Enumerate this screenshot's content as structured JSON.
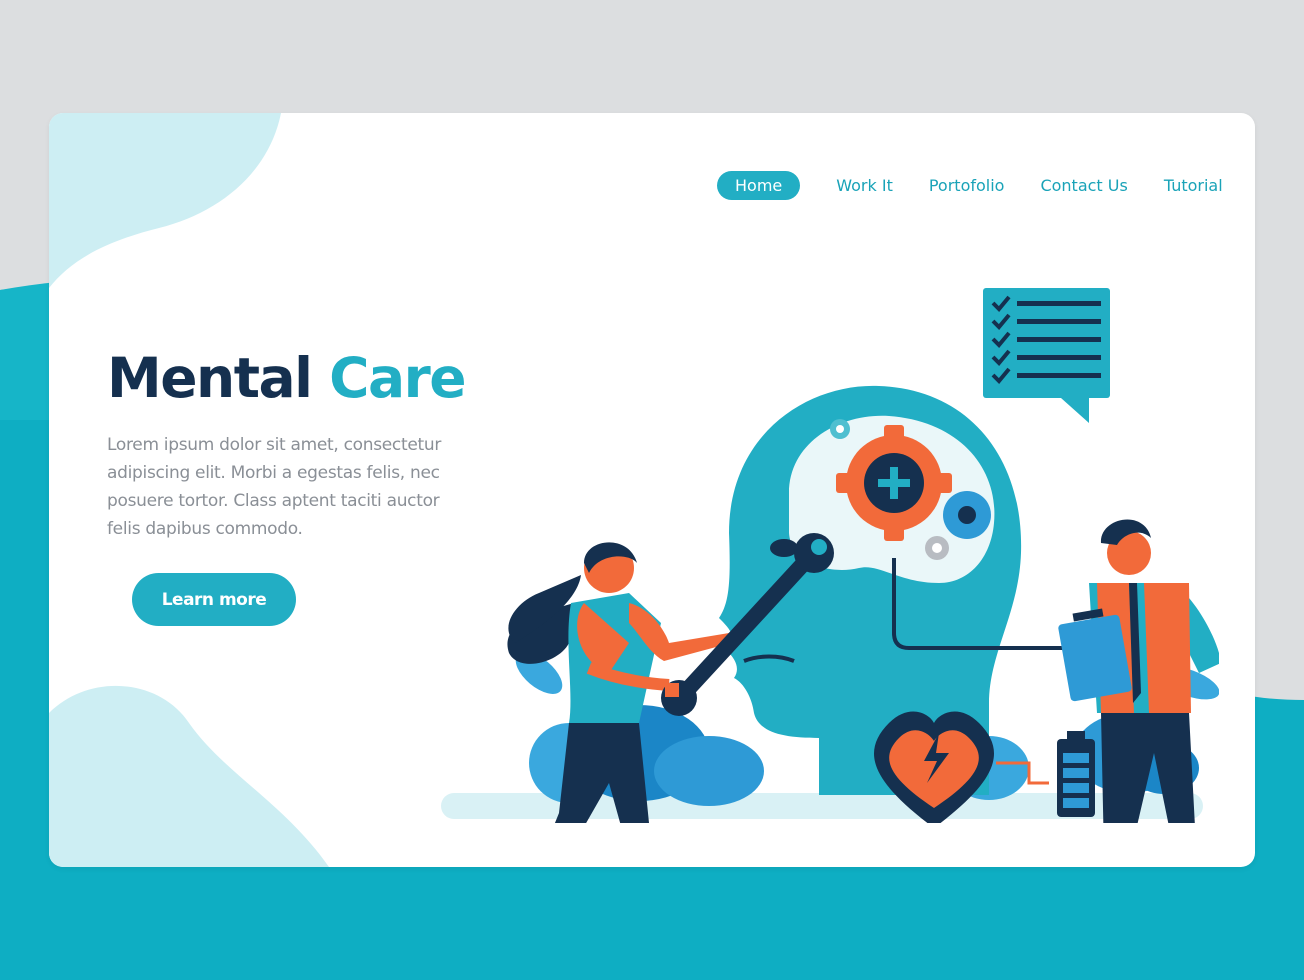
{
  "nav": {
    "items": [
      {
        "label": "Home",
        "active": true
      },
      {
        "label": "Work It",
        "active": false
      },
      {
        "label": "Portofolio",
        "active": false
      },
      {
        "label": "Contact Us",
        "active": false
      },
      {
        "label": "Tutorial",
        "active": false
      }
    ]
  },
  "hero": {
    "title_part1": "Mental",
    "title_part2": "Care",
    "description": "Lorem ipsum dolor sit amet, consectetur adipiscing elit. Morbi a egestas felis, nec posuere tortor. Class aptent taciti auctor felis dapibus commodo.",
    "cta_label": "Learn more"
  },
  "colors": {
    "primary": "#22aec4",
    "dark_navy": "#15304f",
    "accent_orange": "#f26a3a",
    "background_teal": "#0eb0c4",
    "light_teal": "#cdeef3"
  }
}
